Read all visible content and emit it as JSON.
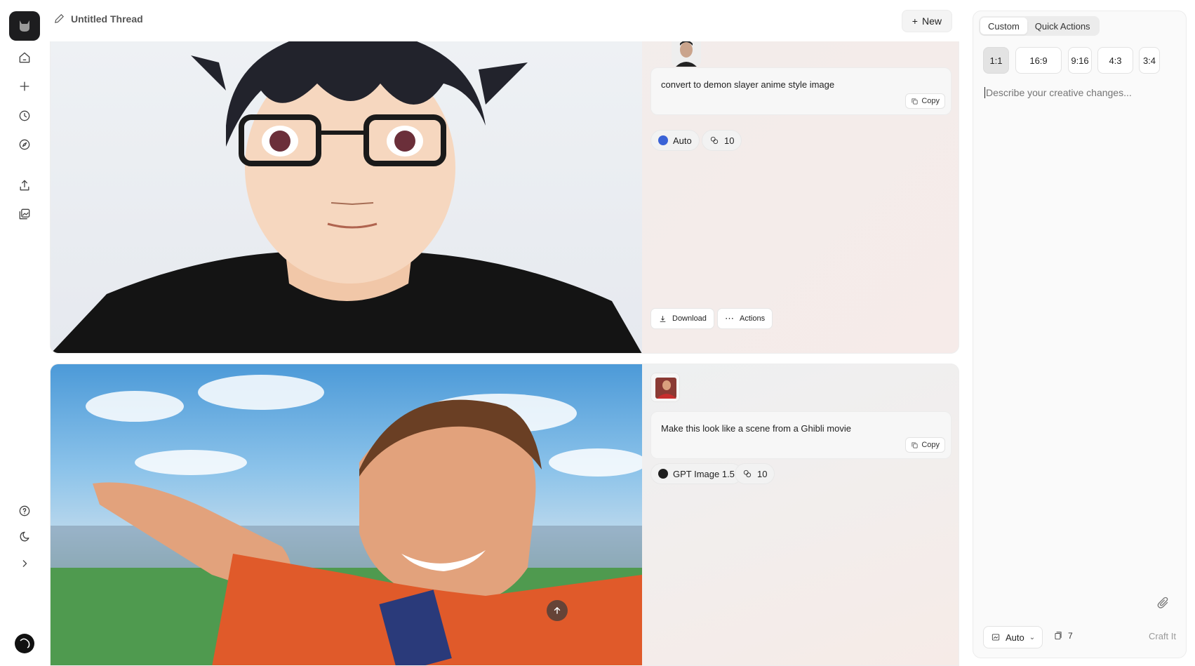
{
  "app": {
    "logo_icon": "cat-logo-icon"
  },
  "sidebar": {
    "items": [
      {
        "name": "home",
        "icon": "home-icon"
      },
      {
        "name": "new",
        "icon": "plus-icon"
      },
      {
        "name": "history",
        "icon": "clock-icon"
      },
      {
        "name": "explore",
        "icon": "compass-icon"
      },
      {
        "name": "upload",
        "icon": "upload-icon"
      },
      {
        "name": "gallery",
        "icon": "image-stack-icon"
      }
    ],
    "bottom": [
      {
        "name": "help",
        "icon": "question-icon"
      },
      {
        "name": "theme",
        "icon": "moon-icon"
      },
      {
        "name": "expand",
        "icon": "chevron-right-icon"
      }
    ]
  },
  "header": {
    "thread_title": "Untitled Thread",
    "new_label": "New"
  },
  "thread": {
    "items": [
      {
        "prompt": "convert to demon slayer anime style image",
        "copy_label": "Copy",
        "model": "Auto",
        "credits": "10",
        "download_label": "Download",
        "actions_label": "Actions"
      },
      {
        "prompt": "Make this look like a scene from a Ghibli movie",
        "copy_label": "Copy",
        "model": "GPT Image 1.5",
        "credits": "10"
      }
    ]
  },
  "panel": {
    "tabs": [
      "Custom",
      "Quick Actions"
    ],
    "active_tab": "Custom",
    "ratios": [
      "1:1",
      "16:9",
      "9:16",
      "4:3",
      "3:4"
    ],
    "active_ratio": "1:1",
    "placeholder": "Describe your creative changes...",
    "model": "Auto",
    "credits": "7",
    "submit_label": "Craft It"
  },
  "colors": {
    "accent": "#1d1d1f",
    "chip_bg": "#f2f2f2",
    "panel_bg": "#fafafa"
  }
}
